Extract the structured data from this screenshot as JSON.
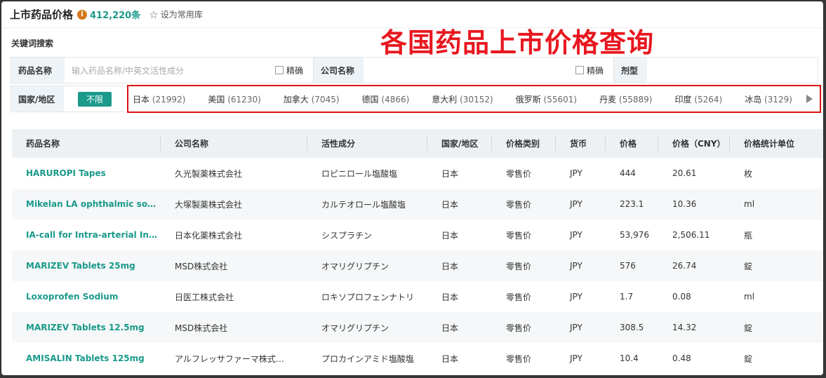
{
  "header": {
    "title": "上市药品价格",
    "info": "i",
    "count": "412,220条",
    "favorite_label": "设为常用库"
  },
  "banner": "各国药品上市价格查询",
  "search": {
    "section_label": "关键词搜索",
    "drug_label": "药品名称",
    "drug_placeholder": "输入药品名称/中英文活性成分",
    "exact_label": "精确",
    "company_label": "公司名称",
    "company_exact_label": "精确",
    "form_label": "剂型"
  },
  "country_filter": {
    "label": "国家/地区",
    "unlimited": "不限",
    "items": [
      {
        "name": "日本",
        "count": "(21992)"
      },
      {
        "name": "美国",
        "count": "(61230)"
      },
      {
        "name": "加拿大",
        "count": "(7045)"
      },
      {
        "name": "德国",
        "count": "(4866)"
      },
      {
        "name": "意大利",
        "count": "(30152)"
      },
      {
        "name": "俄罗斯",
        "count": "(55601)"
      },
      {
        "name": "丹麦",
        "count": "(55889)"
      },
      {
        "name": "印度",
        "count": "(5264)"
      },
      {
        "name": "冰岛",
        "count": "(3129)"
      }
    ]
  },
  "table": {
    "columns": [
      "药品名称",
      "公司名称",
      "活性成分",
      "国家/地区",
      "价格类别",
      "货币",
      "价格",
      "价格（CNY）",
      "价格统计单位"
    ],
    "rows": [
      [
        "HARUROPI Tapes",
        "久光製薬株式会社",
        "ロピニロール塩酸塩",
        "日本",
        "零售价",
        "JPY",
        "444",
        "20.61",
        "枚"
      ],
      [
        "Mikelan LA ophthalmic so…",
        "大塚製薬株式会社",
        "カルテオロール塩酸塩",
        "日本",
        "零售价",
        "JPY",
        "223.1",
        "10.36",
        "ml"
      ],
      [
        "IA-call for Intra-arterial In…",
        "日本化薬株式会社",
        "シスプラチン",
        "日本",
        "零售价",
        "JPY",
        "53,976",
        "2,506.11",
        "瓶"
      ],
      [
        "MARIZEV Tablets 25mg",
        "MSD株式会社",
        "オマリグリプチン",
        "日本",
        "零售价",
        "JPY",
        "576",
        "26.74",
        "錠"
      ],
      [
        "Loxoprofen Sodium",
        "日医工株式会社",
        "ロキソプロフェンナトリ",
        "日本",
        "零售价",
        "JPY",
        "1.7",
        "0.08",
        "ml"
      ],
      [
        "MARIZEV Tablets 12.5mg",
        "MSD株式会社",
        "オマリグリプチン",
        "日本",
        "零售价",
        "JPY",
        "308.5",
        "14.32",
        "錠"
      ],
      [
        "AMISALIN Tablets 125mg",
        "アルフレッサファーマ株式…",
        "プロカインアミド塩酸塩",
        "日本",
        "零售价",
        "JPY",
        "10.4",
        "0.48",
        "錠"
      ]
    ]
  },
  "colors": {
    "accent": "#1a9a8a",
    "banner_red": "#e8171f",
    "info_orange": "#d4791c"
  }
}
